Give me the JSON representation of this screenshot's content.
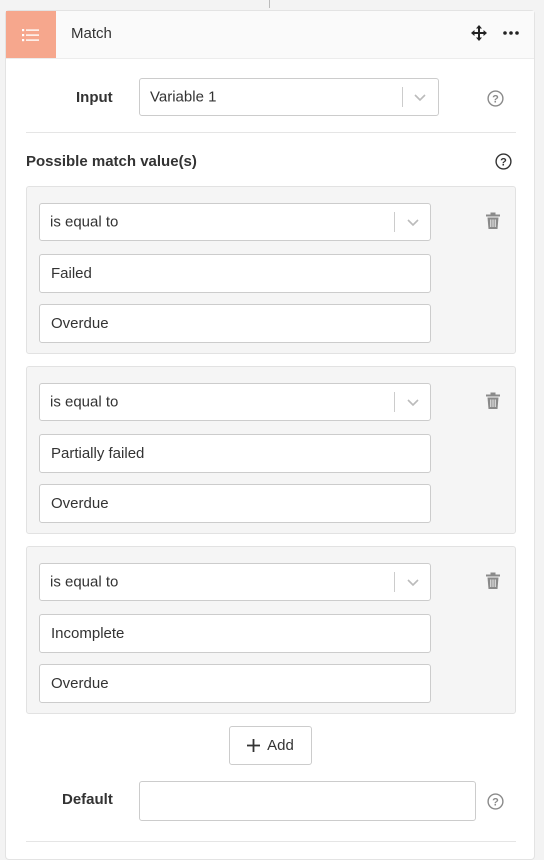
{
  "node": {
    "title": "Match"
  },
  "input": {
    "label": "Input",
    "selected": "Variable 1"
  },
  "possible_values": {
    "label": "Possible match value(s)",
    "groups": [
      {
        "operator": "is equal to",
        "values": [
          "Failed",
          "Overdue"
        ]
      },
      {
        "operator": "is equal to",
        "values": [
          "Partially failed",
          "Overdue"
        ]
      },
      {
        "operator": "is equal to",
        "values": [
          "Incomplete",
          "Overdue"
        ]
      }
    ]
  },
  "add_button": {
    "label": "Add"
  },
  "default": {
    "label": "Default",
    "value": ""
  },
  "colors": {
    "header_icon_bg": "#f6a78d",
    "group_bg": "#f5f5f5",
    "icon_gray": "#8a8a8a"
  },
  "icons": {
    "header": "list-icon",
    "move": "move-icon",
    "more": "more-icon",
    "help": "help-icon",
    "delete": "trash-icon",
    "dropdown": "chevron-down-icon",
    "add": "plus-icon"
  }
}
